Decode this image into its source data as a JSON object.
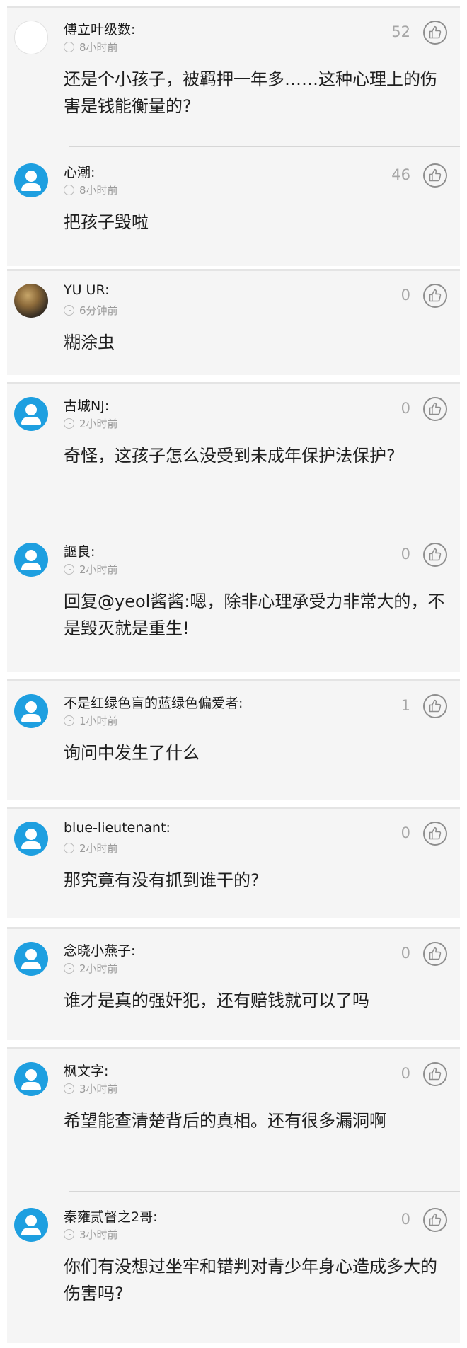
{
  "comments": [
    {
      "user": "傅立叶级数:",
      "time": "8小时前",
      "likes": "52",
      "text": "还是个小孩子，被羁押一年多……这种心理上的伤害是钱能衡量的?",
      "avatar": "blank"
    },
    {
      "user": "心潮:",
      "time": "8小时前",
      "likes": "46",
      "text": "把孩子毁啦",
      "avatar": "default"
    },
    {
      "user": "YU UR:",
      "time": "6分钟前",
      "likes": "0",
      "text": "糊涂虫",
      "avatar": "photo"
    },
    {
      "user": "古城NJ:",
      "time": "2小时前",
      "likes": "0",
      "text": "奇怪，这孩子怎么没受到未成年保护法保护?",
      "avatar": "default"
    },
    {
      "user": "謳良:",
      "time": "2小时前",
      "likes": "0",
      "text": "回复@yeol酱酱:嗯，除非心理承受力非常大的，不是毁灭就是重生!",
      "avatar": "default"
    },
    {
      "user": "不是红绿色盲的蓝绿色偏爱者:",
      "time": "1小时前",
      "likes": "1",
      "text": "询问中发生了什么",
      "avatar": "default"
    },
    {
      "user": "blue-lieutenant:",
      "time": "2小时前",
      "likes": "0",
      "text": "那究竟有没有抓到谁干的?",
      "avatar": "default"
    },
    {
      "user": "念晓小燕子:",
      "time": "2小时前",
      "likes": "0",
      "text": "谁才是真的强奸犯，还有赔钱就可以了吗",
      "avatar": "default"
    },
    {
      "user": "枫文字:",
      "time": "3小时前",
      "likes": "0",
      "text": "希望能查清楚背后的真相。还有很多漏洞啊",
      "avatar": "default"
    },
    {
      "user": "秦雍贰督之2哥:",
      "time": "3小时前",
      "likes": "0",
      "text": "你们有没想过坐牢和错判对青少年身心造成多大的伤害吗?",
      "avatar": "default"
    }
  ]
}
